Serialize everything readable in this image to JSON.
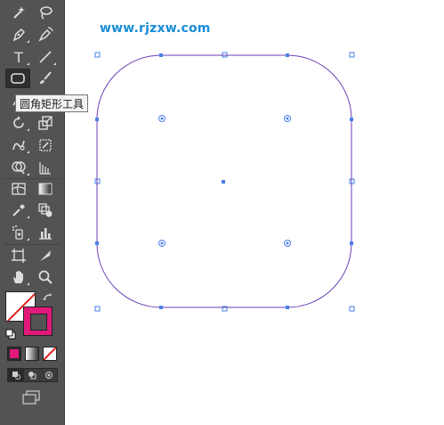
{
  "watermark": "www.rjzxw.com",
  "tooltip": "圆角矩形工具",
  "toolbar": {
    "active_tool": "rounded-rectangle-tool",
    "type_tool_glyph": "T"
  },
  "colors": {
    "toolbar_bg": "#535353",
    "accent_blue": "#4a7fe8",
    "path_purple": "#6a3fb5",
    "stroke_swatch": "#e0197a",
    "watermark": "#1a8dd8"
  }
}
